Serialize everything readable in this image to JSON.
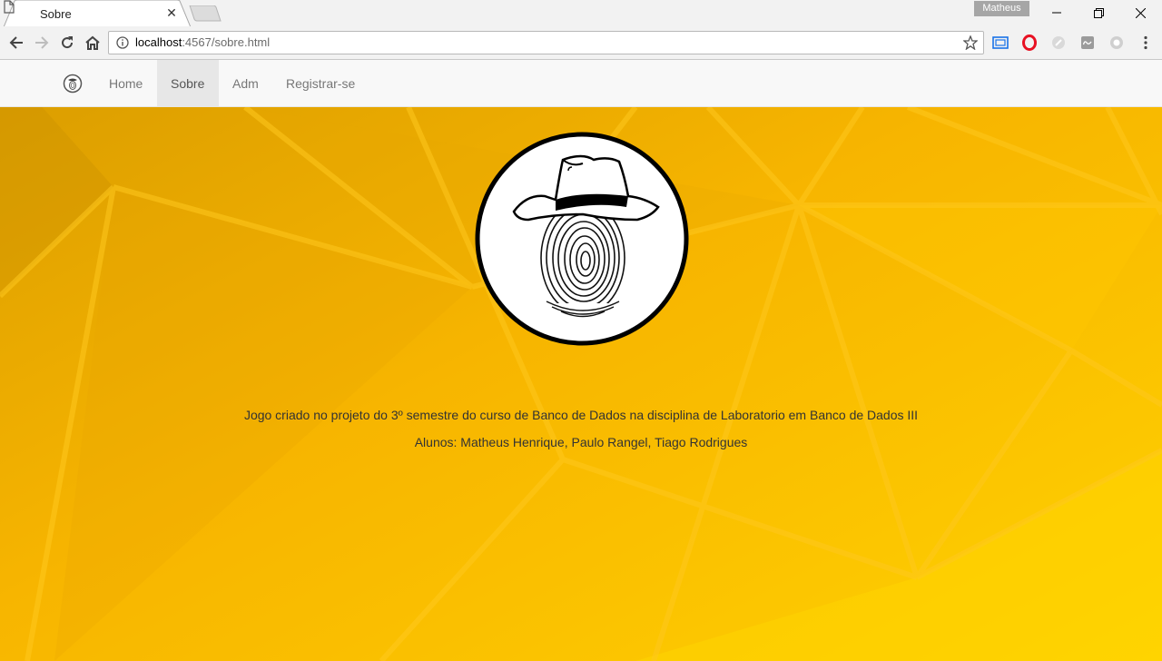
{
  "browser": {
    "tab_title": "Sobre",
    "tab_close": "✕",
    "profile_name": "Matheus",
    "url_host": "localhost",
    "url_path": ":4567/sobre.html",
    "icons": [
      "page-icon",
      "back-icon",
      "forward-icon",
      "reload-icon",
      "home-icon",
      "info-icon",
      "star-icon",
      "cast-icon",
      "opera-icon",
      "extension-icon",
      "lastfm-icon",
      "privacy-icon",
      "menu-icon"
    ]
  },
  "navbar": {
    "brand_icon": "fingerprint-logo-icon",
    "links": [
      {
        "label": "Home",
        "active": false
      },
      {
        "label": "Sobre",
        "active": true
      },
      {
        "label": "Adm",
        "active": false
      },
      {
        "label": "Registrar-se",
        "active": false
      }
    ]
  },
  "content": {
    "logo": "fingerprint-hat-logo",
    "description": "Jogo criado no projeto do 3º semestre do curso de Banco de Dados na disciplina de Laboratorio em Banco de Dados III",
    "students": "Alunos: Matheus Henrique, Paulo Rangel, Tiago Rodrigues"
  },
  "colors": {
    "background": "#f9b800",
    "navbar_bg": "#f8f8f8",
    "nav_active_bg": "#e7e7e7",
    "text": "#333333"
  }
}
